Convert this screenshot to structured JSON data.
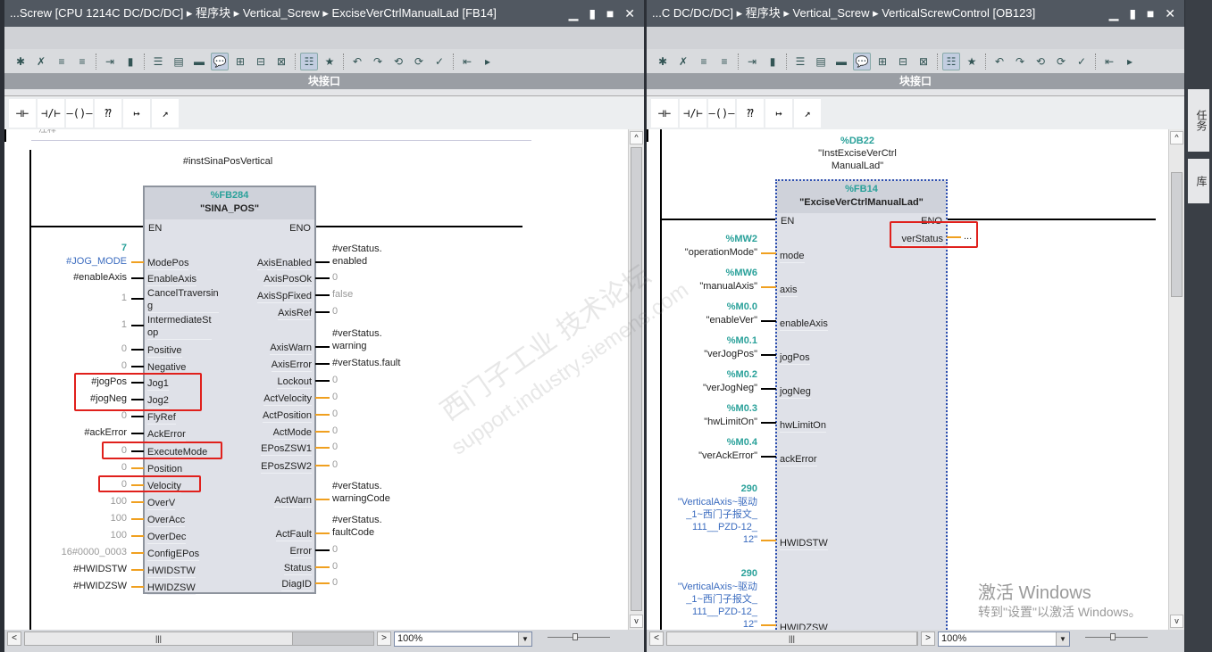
{
  "left": {
    "title": "...Screw [CPU 1214C DC/DC/DC] ▸ 程序块 ▸ Vertical_Screw ▸ ExciseVerCtrlManualLad [FB14]",
    "interface_label": "块接口",
    "comment_stub": "注释",
    "zoom": "100%",
    "block": {
      "instance": "#instSinaPosVertical",
      "number": "%FB284",
      "name": "\"SINA_POS\"",
      "en": "EN",
      "eno": "ENO",
      "inputs": [
        {
          "pin": "ModePos",
          "value": "#JOG_MODE",
          "const": "7",
          "wire": "o",
          "style": "blue"
        },
        {
          "pin": "EnableAxis",
          "value": "#enableAxis",
          "wire": "b",
          "style": ""
        },
        {
          "pin": "CancelTraversin\ng",
          "value": "1",
          "wire": "b",
          "style": "grey"
        },
        {
          "pin": "IntermediateSt\nop",
          "value": "1",
          "wire": "b",
          "style": "grey"
        },
        {
          "pin": "Positive",
          "value": "0",
          "wire": "b",
          "style": "grey"
        },
        {
          "pin": "Negative",
          "value": "0",
          "wire": "b",
          "style": "grey"
        },
        {
          "pin": "Jog1",
          "value": "#jogPos",
          "wire": "b",
          "style": ""
        },
        {
          "pin": "Jog2",
          "value": "#jogNeg",
          "wire": "b",
          "style": ""
        },
        {
          "pin": "FlyRef",
          "value": "0",
          "wire": "b",
          "style": "grey"
        },
        {
          "pin": "AckError",
          "value": "#ackError",
          "wire": "b",
          "style": ""
        },
        {
          "pin": "ExecuteMode",
          "value": "0",
          "wire": "b",
          "style": "grey"
        },
        {
          "pin": "Position",
          "value": "0",
          "wire": "o",
          "style": "grey"
        },
        {
          "pin": "Velocity",
          "value": "0",
          "wire": "o",
          "style": "grey"
        },
        {
          "pin": "OverV",
          "value": "100",
          "wire": "o",
          "style": "grey"
        },
        {
          "pin": "OverAcc",
          "value": "100",
          "wire": "o",
          "style": "grey"
        },
        {
          "pin": "OverDec",
          "value": "100",
          "wire": "o",
          "style": "grey"
        },
        {
          "pin": "ConfigEPos",
          "value": "16#0000_0003",
          "wire": "o",
          "style": "grey"
        },
        {
          "pin": "HWIDSTW",
          "value": "#HWIDSTW",
          "wire": "o",
          "style": ""
        },
        {
          "pin": "HWIDZSW",
          "value": "#HWIDZSW",
          "wire": "o",
          "style": ""
        }
      ],
      "outputs": [
        {
          "pin": "AxisEnabled",
          "value": "#verStatus.\nenabled",
          "wire": "b",
          "style": ""
        },
        {
          "pin": "AxisPosOk",
          "value": "0",
          "wire": "b",
          "style": "grey"
        },
        {
          "pin": "AxisSpFixed",
          "value": "false",
          "wire": "b",
          "style": "grey"
        },
        {
          "pin": "AxisRef",
          "value": "0",
          "wire": "b",
          "style": "grey"
        },
        {
          "pin": "AxisWarn",
          "value": "#verStatus.\nwarning",
          "wire": "b",
          "style": ""
        },
        {
          "pin": "AxisError",
          "value": "#verStatus.fault",
          "wire": "b",
          "style": ""
        },
        {
          "pin": "Lockout",
          "value": "0",
          "wire": "b",
          "style": "grey"
        },
        {
          "pin": "ActVelocity",
          "value": "0",
          "wire": "o",
          "style": "grey"
        },
        {
          "pin": "ActPosition",
          "value": "0",
          "wire": "o",
          "style": "grey"
        },
        {
          "pin": "ActMode",
          "value": "0",
          "wire": "o",
          "style": "grey"
        },
        {
          "pin": "EPosZSW1",
          "value": "0",
          "wire": "o",
          "style": "grey"
        },
        {
          "pin": "EPosZSW2",
          "value": "0",
          "wire": "o",
          "style": "grey"
        },
        {
          "pin": "ActWarn",
          "value": "#verStatus.\nwarningCode",
          "wire": "o",
          "style": ""
        },
        {
          "pin": "ActFault",
          "value": "#verStatus.\nfaultCode",
          "wire": "o",
          "style": ""
        },
        {
          "pin": "Error",
          "value": "0",
          "wire": "b",
          "style": "grey"
        },
        {
          "pin": "Status",
          "value": "0",
          "wire": "o",
          "style": "grey"
        },
        {
          "pin": "DiagID",
          "value": "0",
          "wire": "o",
          "style": "grey"
        }
      ]
    }
  },
  "right": {
    "title": "...C DC/DC/DC] ▸ 程序块 ▸ Vertical_Screw ▸ VerticalScrewControl [OB123]",
    "interface_label": "块接口",
    "zoom": "100%",
    "block": {
      "instance_addr": "%DB22",
      "instance": "\"InstExciseVerCtrl\nManualLad\"",
      "number": "%FB14",
      "name": "\"ExciseVerCtrlManualLad\"",
      "en": "EN",
      "eno": "ENO",
      "inputs": [
        {
          "pin": "mode",
          "addr": "%MW2",
          "value": "\"operationMode\"",
          "wire": "o",
          "style": ""
        },
        {
          "pin": "axis",
          "addr": "%MW6",
          "value": "\"manualAxis\"",
          "wire": "o",
          "style": ""
        },
        {
          "pin": "enableAxis",
          "addr": "%M0.0",
          "value": "\"enableVer\"",
          "wire": "b",
          "style": ""
        },
        {
          "pin": "jogPos",
          "addr": "%M0.1",
          "value": "\"verJogPos\"",
          "wire": "b",
          "style": ""
        },
        {
          "pin": "jogNeg",
          "addr": "%M0.2",
          "value": "\"verJogNeg\"",
          "wire": "b",
          "style": ""
        },
        {
          "pin": "hwLimitOn",
          "addr": "%M0.3",
          "value": "\"hwLimitOn\"",
          "wire": "b",
          "style": ""
        },
        {
          "pin": "ackError",
          "addr": "%M0.4",
          "value": "\"verAckError\"",
          "wire": "b",
          "style": ""
        },
        {
          "pin": "HWIDSTW",
          "addr": "290",
          "value": "\"VerticalAxis~驱动\n_1~西门子报文_\n111__PZD-12_\n12\"",
          "wire": "o",
          "style": "blue"
        },
        {
          "pin": "HWIDZSW",
          "addr": "290",
          "value": "\"VerticalAxis~驱动\n_1~西门子报文_\n111__PZD-12_\n12\"",
          "wire": "o",
          "style": "blue"
        }
      ],
      "outputs": [
        {
          "pin": "verStatus",
          "value": "...",
          "wire": "o",
          "style": ""
        }
      ]
    }
  },
  "side_tabs": [
    "任务",
    "库"
  ],
  "watermark": [
    "西门子工业 技术论坛",
    "support.industry.siemens.com"
  ],
  "activation": {
    "line1": "激活 Windows",
    "line2": "转到\"设置\"以激活 Windows。"
  },
  "palette": [
    "⊣⊢",
    "⊣/⊢",
    "–()–",
    "⁇",
    "↦",
    "↗"
  ]
}
